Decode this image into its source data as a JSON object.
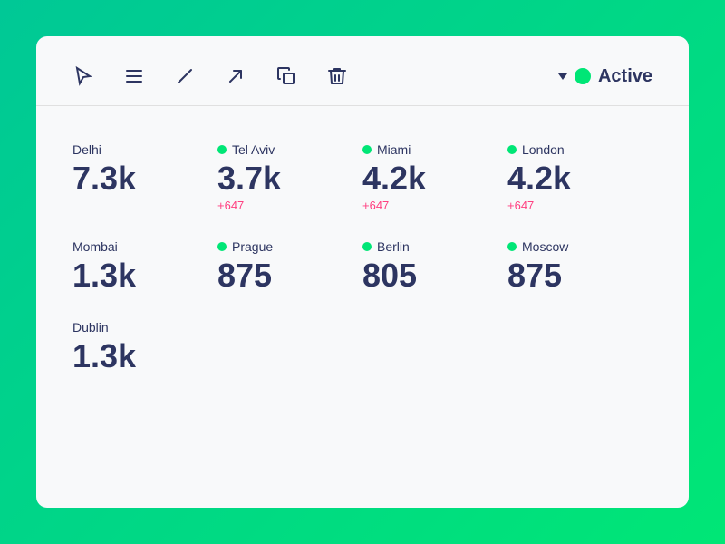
{
  "toolbar": {
    "cursor_icon": "▸",
    "list_icon": "list",
    "pen_icon": "pen",
    "arrow_icon": "arrow",
    "copy_icon": "copy",
    "trash_icon": "trash",
    "status": {
      "label": "Active"
    }
  },
  "cities": [
    {
      "name": "Delhi",
      "value": "7.3k",
      "delta": "",
      "partial": true
    },
    {
      "name": "Tel Aviv",
      "value": "3.7k",
      "delta": "+647",
      "partial": false
    },
    {
      "name": "Miami",
      "value": "4.2k",
      "delta": "+647",
      "partial": false
    },
    {
      "name": "London",
      "value": "4.2k",
      "delta": "+647",
      "partial": false
    },
    {
      "name": "Mombai",
      "value": "1.3k",
      "delta": "",
      "partial": true
    },
    {
      "name": "Prague",
      "value": "875",
      "delta": "",
      "partial": false
    },
    {
      "name": "Berlin",
      "value": "805",
      "delta": "",
      "partial": false
    },
    {
      "name": "Moscow",
      "value": "875",
      "delta": "",
      "partial": false
    },
    {
      "name": "Dublin",
      "value": "1.3k",
      "delta": "",
      "partial": true
    }
  ]
}
